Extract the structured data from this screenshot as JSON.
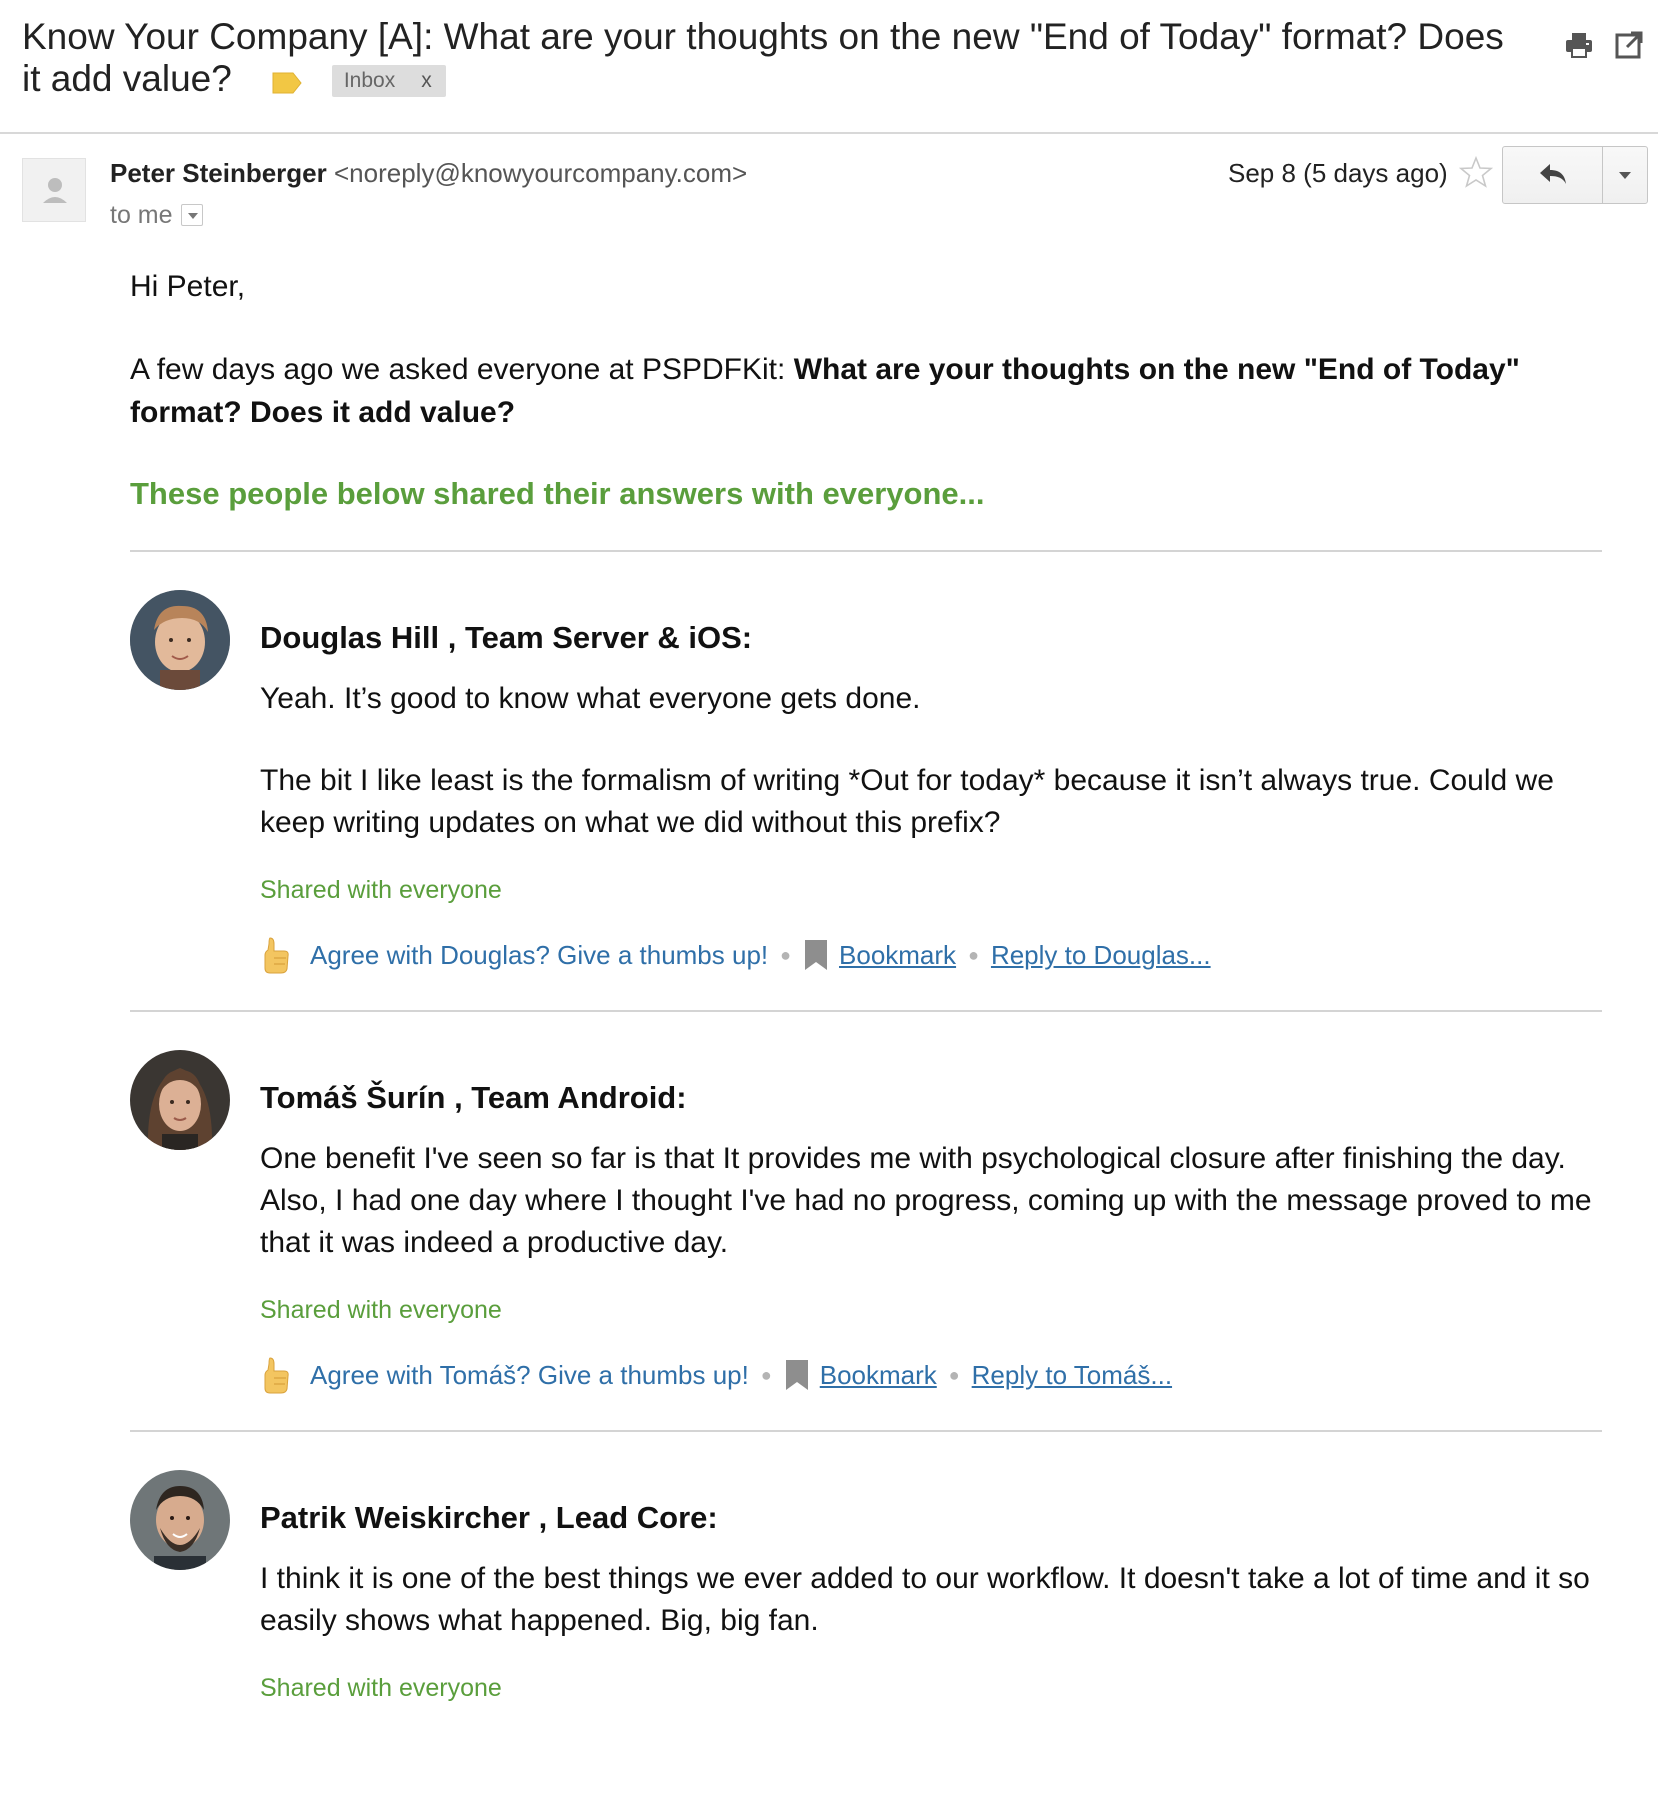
{
  "subject": {
    "title": "Know Your Company [A]: What are your thoughts on the new \"End of Today\" format? Does it add value?",
    "label_chip": "Inbox",
    "label_chip_close": "x"
  },
  "message": {
    "sender_name": "Peter Steinberger",
    "sender_email": "<noreply@knowyourcompany.com>",
    "to_text": "to me",
    "date": "Sep 8 (5 days ago)"
  },
  "body": {
    "greeting": "Hi Peter,",
    "intro_text": "A few days ago we asked everyone at PSPDFKit: ",
    "intro_question": "What are your thoughts on the new \"End of Today\" format? Does it add value?",
    "shared_heading": "These people below shared their answers with everyone..."
  },
  "answers": [
    {
      "title": "Douglas Hill , Team Server & iOS:",
      "paragraphs": [
        "Yeah. It’s good to know what everyone gets done.",
        "The bit I like least is the formalism of writing *Out for today* because it isn’t always true. Could we keep writing updates on what we did without this prefix?"
      ],
      "shared": "Shared with everyone",
      "thumbs": "Agree with Douglas? Give a thumbs up!",
      "bookmark": "Bookmark",
      "reply": "Reply to Douglas..."
    },
    {
      "title": "Tomáš Šurín , Team Android:",
      "paragraphs": [
        "One benefit I've seen so far is that It provides me with psychological closure after finishing the day. Also, I had one day where I thought I've had no progress, coming up with the message proved to me that it was indeed a productive day."
      ],
      "shared": "Shared with everyone",
      "thumbs": "Agree with Tomáš? Give a thumbs up!",
      "bookmark": "Bookmark",
      "reply": "Reply to Tomáš..."
    },
    {
      "title": "Patrik Weiskircher , Lead Core:",
      "paragraphs": [
        "I think it is one of the best things we ever added to our workflow. It doesn't take a lot of time and it so easily shows what happened. Big, big fan."
      ],
      "shared": "Shared with everyone"
    }
  ],
  "icons": {
    "print": "printer-icon",
    "popout": "new-window-icon",
    "star": "star-icon",
    "reply": "reply-arrow-icon",
    "thumb": "thumbs-up-icon",
    "bookmark": "bookmark-icon"
  },
  "colors": {
    "green": "#5a9e3c",
    "link": "#2f6fa8",
    "label": "#f2c744"
  }
}
